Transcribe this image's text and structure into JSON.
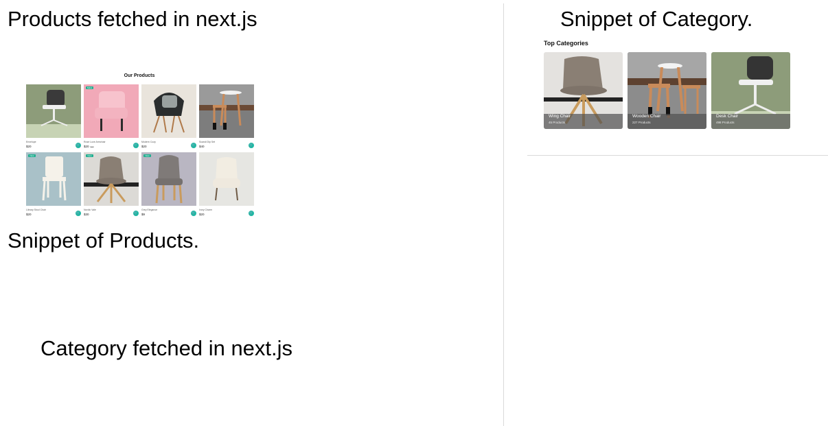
{
  "labels": {
    "products_fetched": "Products fetched in next.js",
    "snippet_products": "Snippet of Products.",
    "category_fetched": "Category fetched in next.js",
    "snippet_category": "Snippet of Category."
  },
  "products_snippet": {
    "title": "Our Products",
    "cart_icon": "cart-icon",
    "items": [
      {
        "name": "Envelope",
        "price": "$20",
        "old_price": "",
        "badge": ""
      },
      {
        "name": "Rose Luxe Armchair",
        "price": "$20",
        "old_price": "$30",
        "badge": "Sales"
      },
      {
        "name": "Modern Cozy",
        "price": "$20",
        "old_price": "",
        "badge": ""
      },
      {
        "name": "Scandi Dip Set",
        "price": "$40",
        "old_price": "",
        "badge": ""
      },
      {
        "name": "Library Stool Chair",
        "price": "$20",
        "old_price": "",
        "badge": "New"
      },
      {
        "name": "Nordic Vale",
        "price": "$30",
        "old_price": "",
        "badge": "New"
      },
      {
        "name": "Grey Elegance",
        "price": "$9",
        "old_price": "",
        "badge": "New"
      },
      {
        "name": "Ivory Charm",
        "price": "$20",
        "old_price": "",
        "badge": ""
      }
    ]
  },
  "category_snippet": {
    "title": "Top Categories",
    "items": [
      {
        "name": "Wing Chair",
        "count": "45 Products"
      },
      {
        "name": "Wooden Chair",
        "count": "227 Products"
      },
      {
        "name": "Desk Chair",
        "count": "498 Products"
      }
    ]
  },
  "colors": {
    "accent": "#1fb8a4",
    "badge": "#1fae8f",
    "divider": "#d9d9d9"
  }
}
